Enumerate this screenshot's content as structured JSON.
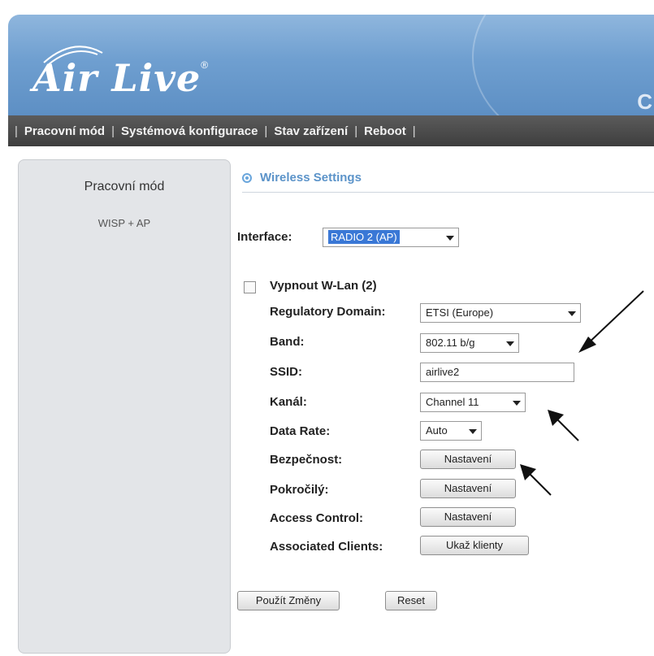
{
  "header": {
    "logo_text": "Air Live",
    "right_text": "C"
  },
  "nav": {
    "items": [
      "Pracovní mód",
      "Systémová konfigurace",
      "Stav zařízení",
      "Reboot"
    ],
    "separator": "|"
  },
  "sidebar": {
    "title": "Pracovní mód",
    "mode": "WISP + AP"
  },
  "section": {
    "title": "Wireless Settings"
  },
  "form": {
    "interface_label": "Interface:",
    "interface_value": "RADIO 2 (AP)",
    "disable_wlan_label": "Vypnout W-Lan (2)",
    "disable_wlan_checked": false,
    "regulatory_label": "Regulatory Domain:",
    "regulatory_value": "ETSI (Europe)",
    "band_label": "Band:",
    "band_value": "802.11 b/g",
    "ssid_label": "SSID:",
    "ssid_value": "airlive2",
    "channel_label": "Kanál:",
    "channel_value": "Channel 11",
    "datarate_label": "Data Rate:",
    "datarate_value": "Auto",
    "security_label": "Bezpečnost:",
    "security_button": "Nastavení",
    "advanced_label": "Pokročilý:",
    "advanced_button": "Nastavení",
    "access_label": "Access Control:",
    "access_button": "Nastavení",
    "clients_label": "Associated Clients:",
    "clients_button": "Ukaž klienty"
  },
  "actions": {
    "apply": "Použít Změny",
    "reset": "Reset"
  }
}
